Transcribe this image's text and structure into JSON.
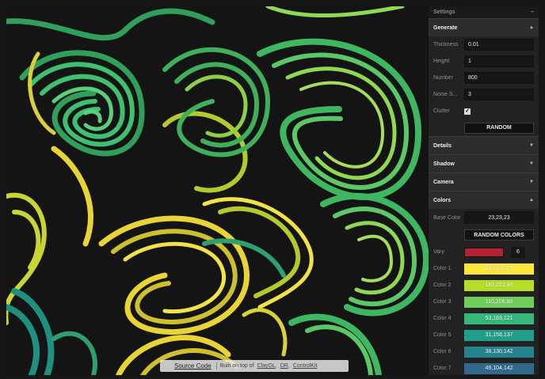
{
  "panel": {
    "title": "Settings",
    "collapse_icon": "minus-icon",
    "generate": {
      "title": "Generate",
      "thickness_label": "Thickness",
      "thickness_value": "0.01",
      "height_label": "Height",
      "height_value": "1",
      "number_label": "Number",
      "number_value": "800",
      "noise_label": "Noise S...",
      "noise_value": "3",
      "clutter_label": "Clutter",
      "clutter_checked": "✓",
      "random_button": "RANDOM"
    },
    "sections": {
      "details": "Details",
      "shadow": "Shadow",
      "camera": "Camera"
    },
    "colors": {
      "title": "Colors",
      "base_label": "Base Color",
      "base_value": "23,23,23",
      "random_colors_button": "RANDOM COLORS",
      "vary_label": "Vary",
      "vary_value": "6",
      "vary_color": "#b52230",
      "items": [
        {
          "label": "Color 1",
          "value": "252,231,57",
          "hex": "#fce739"
        },
        {
          "label": "Color 2",
          "value": "181,222,43",
          "hex": "#b5de2b"
        },
        {
          "label": "Color 3",
          "value": "110,206,88",
          "hex": "#6ece58"
        },
        {
          "label": "Color 4",
          "value": "53,183,121",
          "hex": "#35b779"
        },
        {
          "label": "Color 5",
          "value": "31,158,137",
          "hex": "#1f9e89"
        },
        {
          "label": "Color 6",
          "value": "38,130,142",
          "hex": "#26828e"
        },
        {
          "label": "Color 7",
          "value": "49,104,142",
          "hex": "#31688e"
        }
      ]
    }
  },
  "footer": {
    "source_link": "Source Code",
    "built_text": "Built on top of",
    "link1": "ClayGL",
    "link2": "DR",
    "link3": "ControlKit"
  }
}
